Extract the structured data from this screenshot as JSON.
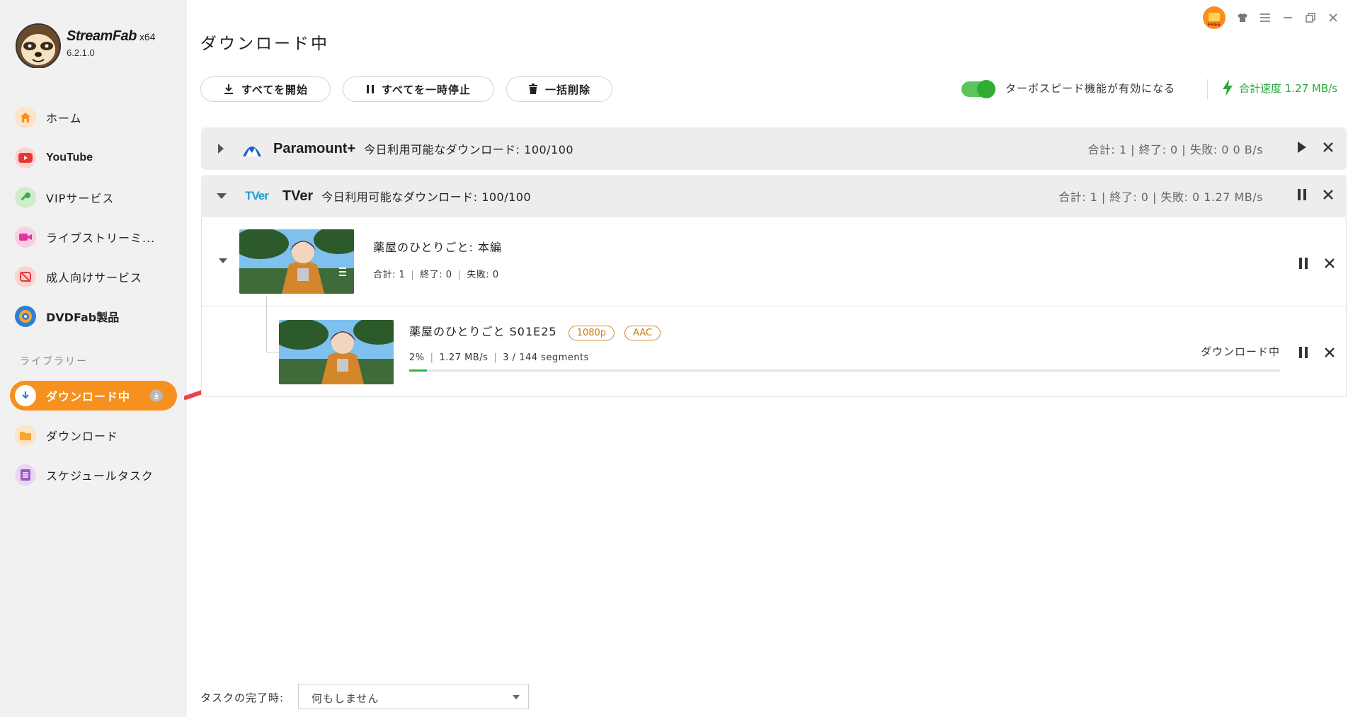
{
  "app": {
    "name": "StreamFab",
    "arch": "x64",
    "version": "6.2.1.0"
  },
  "sidebar": {
    "items": [
      {
        "label": "ホーム",
        "icon": "home-icon",
        "color": "#f6901e"
      },
      {
        "label": "YouTube",
        "icon": "youtube-icon",
        "color": "#e53935"
      },
      {
        "label": "VIPサービス",
        "icon": "key-icon",
        "color": "#3fae3f"
      },
      {
        "label": "ライブストリーミ...",
        "icon": "live-camera-icon",
        "color": "#e0349a"
      },
      {
        "label": "成人向けサービス",
        "icon": "adult-blocked-icon",
        "color": "#e53935"
      },
      {
        "label": "DVDFab製品",
        "icon": "dvdfab-icon",
        "color": "#2f7fd6"
      }
    ],
    "library_label": "ライブラリー",
    "library": [
      {
        "label": "ダウンロード中",
        "icon": "download-arrow-icon",
        "active": true
      },
      {
        "label": "ダウンロード",
        "icon": "folder-icon",
        "color": "#f6a631"
      },
      {
        "label": "スケジュールタスク",
        "icon": "schedule-icon",
        "color": "#9b59c4"
      }
    ]
  },
  "page": {
    "title": "ダウンロード中"
  },
  "toolbar": {
    "start_all": "すべてを開始",
    "pause_all": "すべてを一時停止",
    "delete_all": "一括削除",
    "turbo_label": "ターボスピード機能が有効になる",
    "turbo_on": true,
    "total_speed": "合計速度 1.27 MB/s"
  },
  "groups": [
    {
      "name": "Paramount+",
      "quota": "今日利用可能なダウンロード: 100/100",
      "stats": "合計: 1 | 終了: 0 | 失敗: 0    0 B/s",
      "expanded": false
    },
    {
      "name": "TVer",
      "logo_text": "TVer",
      "quota": "今日利用可能なダウンロード: 100/100",
      "stats": "合計: 1 | 終了: 0 | 失敗: 0    1.27 MB/s",
      "expanded": true
    }
  ],
  "series": {
    "title": "薬屋のひとりごと: 本編",
    "total": "合計: 1",
    "done": "終了: 0",
    "failed": "失敗: 0"
  },
  "episode": {
    "title": "薬屋のひとりごと S01E25",
    "quality_tag": "1080p",
    "audio_tag": "AAC",
    "percent_text": "2%",
    "progress": 0.02,
    "speed": "1.27 MB/s",
    "segments": "3 / 144 segments",
    "status": "ダウンロード中"
  },
  "footer": {
    "label": "タスクの完了時:",
    "select_value": "何もしません"
  }
}
